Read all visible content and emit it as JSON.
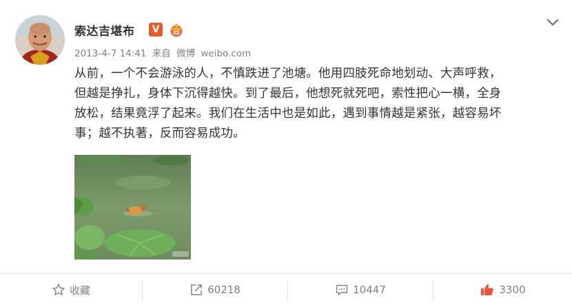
{
  "user": {
    "name": "索达吉堪布",
    "verified_badge": "V",
    "member_icon": "crown-member-icon"
  },
  "post": {
    "timestamp": "2013-4-7 14:41",
    "source_prefix": "来自",
    "source_app": "微博",
    "source_site": "weibo.com",
    "text_lines": [
      "从前，一个不会游泳的人，不慎跌进了池塘。他用四肢死命地划动、大声呼救，",
      "但越是挣扎，身体下沉得越快。到了最后，他想死就死吧，索性把心一横，全身",
      "放松，结果竟浮了起来。我们在生活中也是如此，遇到事情越是紧张，越容易坏",
      "事；越不执著，反而容易成功。"
    ]
  },
  "actions": {
    "favorite_label": "收藏",
    "repost_count": "60218",
    "comment_count": "10447",
    "like_count": "3300"
  },
  "colors": {
    "like": "#e8553e",
    "badge": "#e85b2b",
    "meta": "#808080"
  }
}
